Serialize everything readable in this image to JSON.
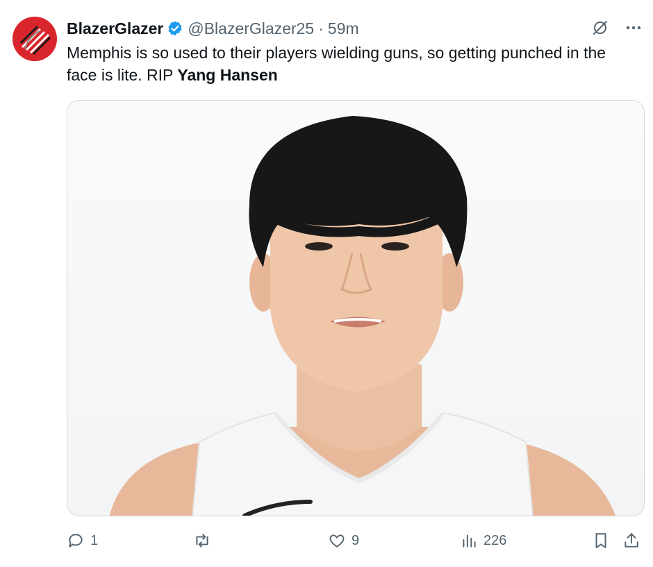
{
  "tweet": {
    "display_name": "BlazerGlazer",
    "handle": "@BlazerGlazer25",
    "separator": "·",
    "time": "59m",
    "text_main": "Memphis is so used to their players wielding guns, so getting punched in the face is lite. RIP ",
    "text_bold": "Yang Hansen",
    "avatar_icon": "blazers-pinwheel-logo",
    "verified_icon": "verified-badge-icon",
    "accent_color": "#1d9bf0",
    "avatar_color": "#d9262c"
  },
  "header_icons": [
    "grok-icon",
    "more-icon"
  ],
  "media": {
    "description_icon": "player-headshot-photo"
  },
  "actions": {
    "reply_count": "1",
    "retweet_count": "",
    "like_count": "9",
    "views_count": "226"
  }
}
